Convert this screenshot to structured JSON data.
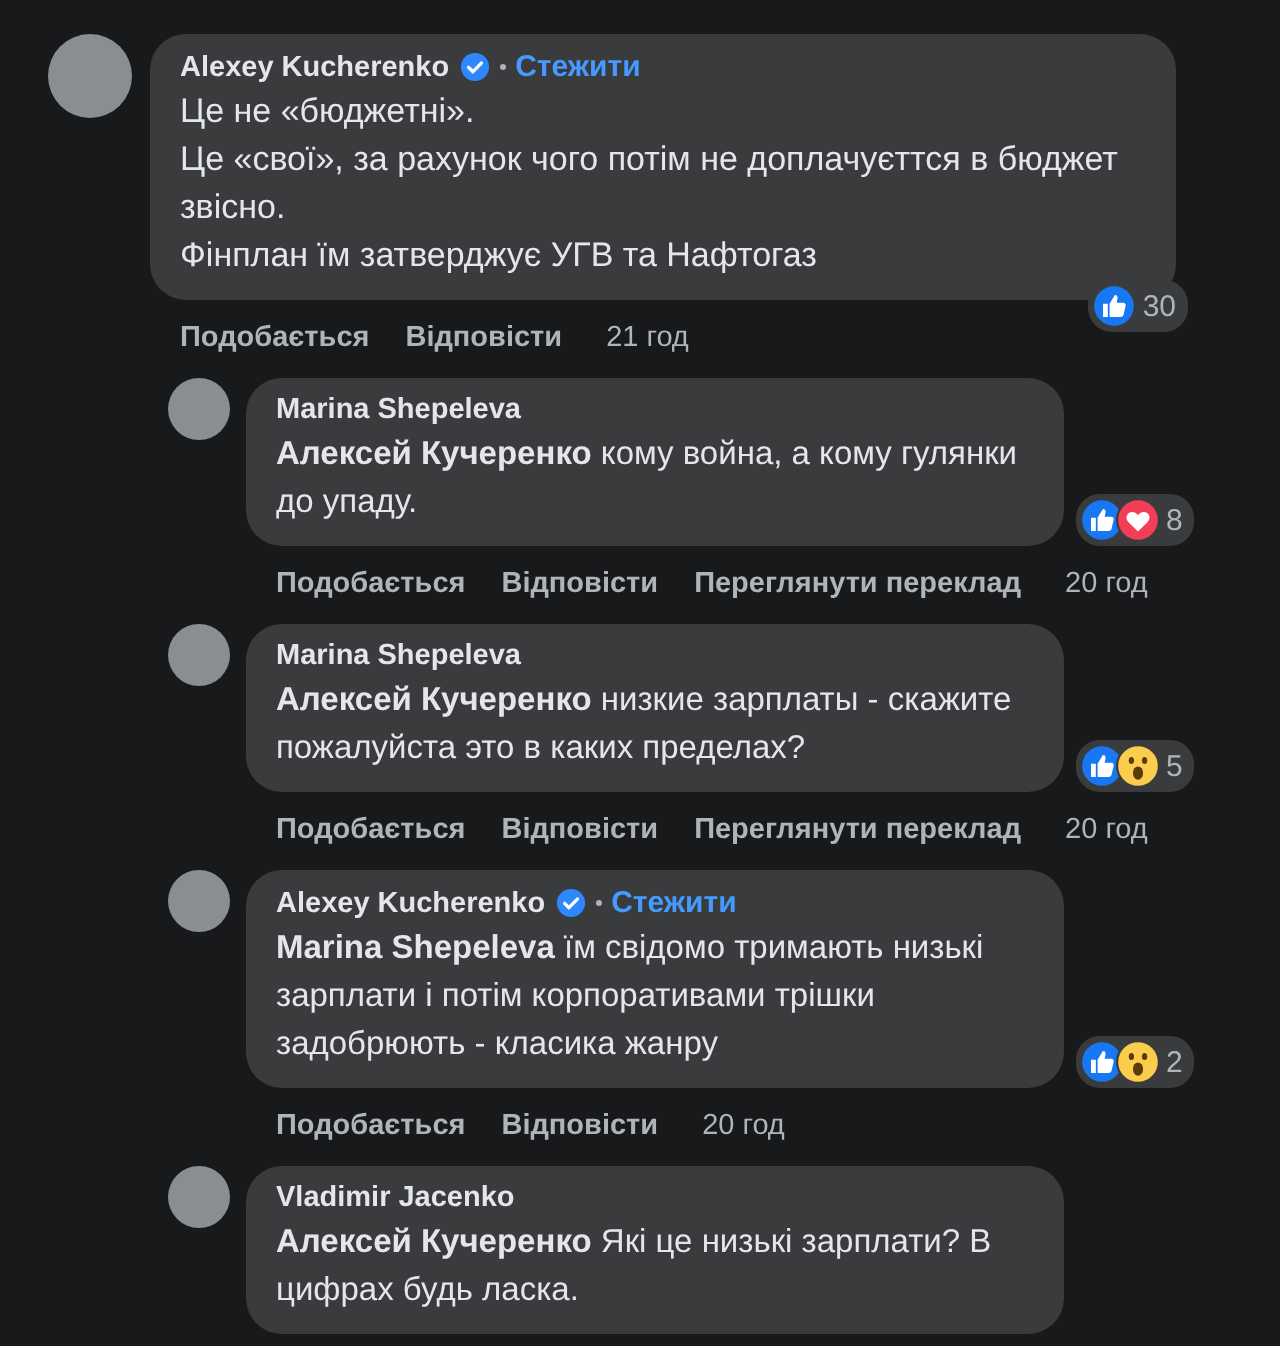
{
  "comments": [
    {
      "author": "Alexey Kucherenko",
      "verified": true,
      "follow": "Стежити",
      "paragraphs": [
        "Це не «бюджетні».",
        "Це «свої», за рахунок чого потім не доплачуєттся в бюджет звісно.",
        "Фінплан їм затверджує УГВ та Нафтогаз"
      ],
      "reactions": [
        {
          "kind": "like"
        }
      ],
      "reaction_count": "30",
      "actions": [
        "Подобається",
        "Відповісти"
      ],
      "time": "21 год",
      "children": [
        {
          "author": "Marina Shepeleva",
          "verified": false,
          "paragraphs": [
            "**Алексей Кучеренко** кому война, а кому гулянки до упаду."
          ],
          "reactions": [
            {
              "kind": "like"
            },
            {
              "kind": "love"
            }
          ],
          "reaction_count": "8",
          "actions": [
            "Подобається",
            "Відповісти",
            "Переглянути переклад"
          ],
          "time": "20 год"
        },
        {
          "author": "Marina Shepeleva",
          "verified": false,
          "paragraphs": [
            "**Алексей Кучеренко** низкие зарплаты - скажите пожалуйста это в каких пределах?"
          ],
          "reactions": [
            {
              "kind": "like"
            },
            {
              "kind": "wow"
            }
          ],
          "reaction_count": "5",
          "actions": [
            "Подобається",
            "Відповісти",
            "Переглянути переклад"
          ],
          "time": "20 год"
        },
        {
          "author": "Alexey Kucherenko",
          "verified": true,
          "follow": "Стежити",
          "paragraphs": [
            "**Marina Shepeleva** їм свідомо тримають низькі зарплати і потім корпоративами трішки задобрюють - класика жанру"
          ],
          "reactions": [
            {
              "kind": "like"
            },
            {
              "kind": "wow"
            }
          ],
          "reaction_count": "2",
          "actions": [
            "Подобається",
            "Відповісти"
          ],
          "time": "20 год"
        },
        {
          "author": "Vladimir Jacenko",
          "verified": false,
          "paragraphs": [
            "**Алексей Кучеренко** Які це низькі зарплати? В цифрах будь ласка."
          ]
        }
      ]
    }
  ]
}
